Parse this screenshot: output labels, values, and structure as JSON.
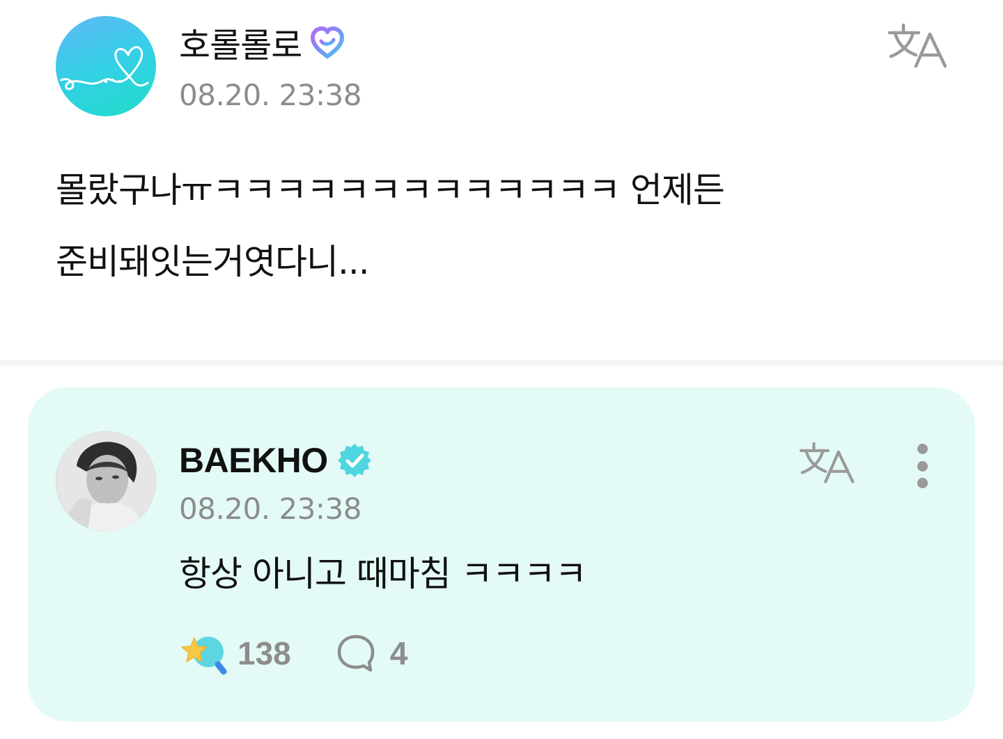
{
  "post": {
    "author": "호롤롤로",
    "timestamp": "08.20. 23:38",
    "text_line1": "몰랐구나ㅠㅋㅋㅋㅋㅋㅋㅋㅋㅋㅋㅋㅋㅋ 언제든",
    "text_line2": "준비돼잇는거엿다니..."
  },
  "reply": {
    "author": "BAEKHO",
    "timestamp": "08.20. 23:38",
    "text": "항상 아니고 때마침 ㅋㅋㅋㅋ",
    "like_count": "138",
    "comment_count": "4"
  },
  "icons": {
    "post_avatar": "heart-doodle-avatar",
    "post_badge": "membership-heart-badge-icon",
    "translate": "translate-icon",
    "verified": "verified-badge-icon",
    "more": "more-vertical-icon",
    "like": "star-fan-like-icon",
    "comment": "comment-bubble-icon"
  },
  "colors": {
    "reply_card_bg": "#e4faf6",
    "verified_badge": "#4fd6e0",
    "timestamp": "#8c8c8c",
    "count_text": "#8d8d8d"
  }
}
